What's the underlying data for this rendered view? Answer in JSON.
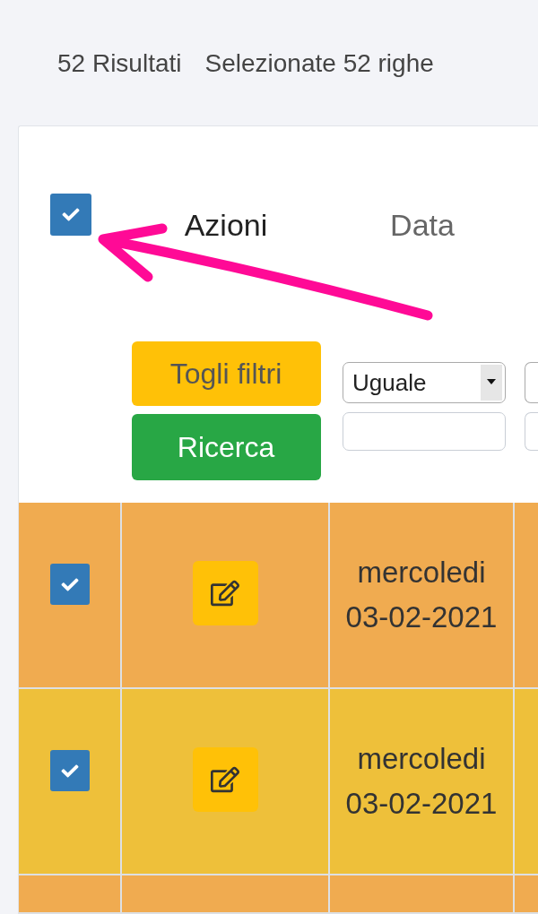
{
  "summary": {
    "results": "52 Risultati",
    "selected": "Selezionate 52 righe"
  },
  "table": {
    "select_all": {
      "checked": true
    },
    "columns": [
      {
        "kind": "static",
        "label": "Azioni"
      },
      {
        "kind": "sortable",
        "label": "Data"
      }
    ],
    "filter_buttons": [
      {
        "kind": "clear",
        "label": "Togli filtri"
      },
      {
        "kind": "search",
        "label": "Ricerca"
      }
    ],
    "column_filters": [
      {
        "operator": "Uguale"
      }
    ],
    "rows": [
      {
        "color": "#f0ab50",
        "checked": true,
        "weekday": "mercoledi",
        "date": "03-02-2021"
      },
      {
        "color": "#eec03a",
        "checked": true,
        "weekday": "mercoledi",
        "date": "03-02-2021"
      },
      {
        "color": "#f0ab50"
      }
    ]
  }
}
